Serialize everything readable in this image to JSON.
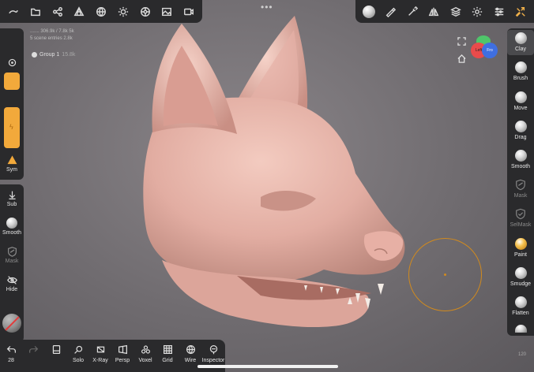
{
  "scene": {
    "info_line1": "....... 306.9k / 7.8k 5k",
    "info_line2": "5 scene entries 2.8k",
    "group_name": "Group 1",
    "group_count": "15.8k"
  },
  "top_left_icons": [
    "menu-icon",
    "folder-icon",
    "share-nodes-icon",
    "mesh-icon",
    "globe-icon",
    "light-icon",
    "settings-wheel-icon",
    "image-icon",
    "video-icon"
  ],
  "top_right_icons": [
    "material-ball-icon",
    "brush-stroke-icon",
    "eyedropper-icon",
    "symmetry-icon",
    "layers-icon",
    "gear-icon",
    "sliders-icon",
    "tools-icon"
  ],
  "more_dots": "•••",
  "left_tools": {
    "sym": "Sym",
    "sub": "Sub",
    "smooth": "Smooth",
    "mask": "Mask",
    "hide": "Hide"
  },
  "right_tools": [
    {
      "key": "clay",
      "label": "Clay"
    },
    {
      "key": "brush",
      "label": "Brush"
    },
    {
      "key": "move",
      "label": "Move"
    },
    {
      "key": "drag",
      "label": "Drag"
    },
    {
      "key": "smooth",
      "label": "Smooth"
    },
    {
      "key": "mask",
      "label": "Mask"
    },
    {
      "key": "selmask",
      "label": "SelMask"
    },
    {
      "key": "paint",
      "label": "Paint"
    },
    {
      "key": "smudge",
      "label": "Smudge"
    },
    {
      "key": "flatten",
      "label": "Flatten"
    }
  ],
  "gizmo": {
    "left": "Left",
    "front": "Fro"
  },
  "bottom_tools": {
    "undo_count": "28",
    "solo": "Solo",
    "xray": "X-Ray",
    "persp": "Persp",
    "voxel": "Voxel",
    "grid": "Grid",
    "wire": "Wire",
    "inspector": "Inspector"
  },
  "fps": "120",
  "colors": {
    "accent": "#f2a93b",
    "panel": "#2a2a2c",
    "model": "#e8b9ae",
    "cursor": "#d18a1e"
  }
}
